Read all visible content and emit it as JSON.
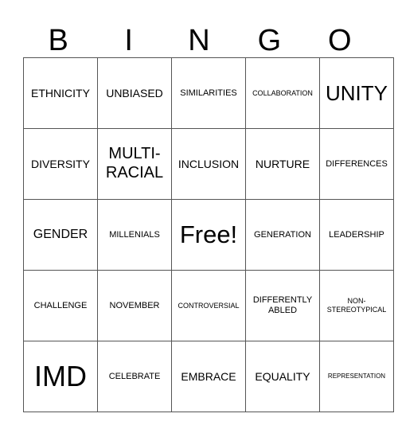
{
  "header": [
    "B",
    "I",
    "N",
    "G",
    "O"
  ],
  "rows": [
    [
      "ETHNICITY",
      "UNBIASED",
      "SIMILARITIES",
      "COLLABORATION",
      "UNITY"
    ],
    [
      "DIVERSITY",
      "MULTI-RACIAL",
      "INCLUSION",
      "NURTURE",
      "DIFFERENCES"
    ],
    [
      "GENDER",
      "MILLENIALS",
      "Free!",
      "GENERATION",
      "LEADERSHIP"
    ],
    [
      "CHALLENGE",
      "NOVEMBER",
      "CONTROVERSIAL",
      "DIFFERENTLY ABLED",
      "NON-STEREOTYPICAL"
    ],
    [
      "IMD",
      "CELEBRATE",
      "EMBRACE",
      "EQUALITY",
      "REPRESENTATION"
    ]
  ]
}
